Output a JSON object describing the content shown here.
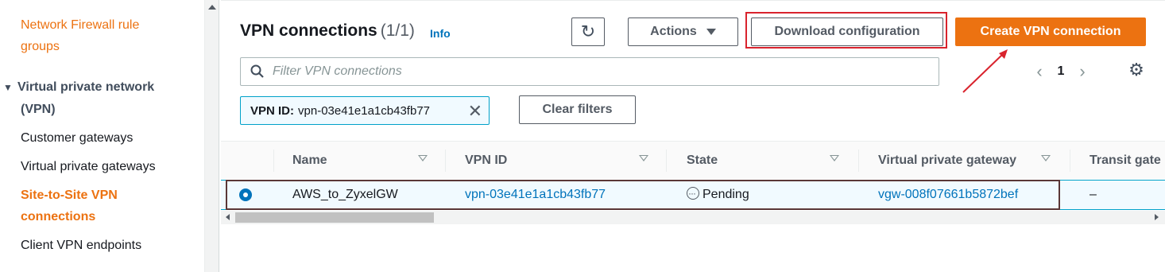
{
  "sidebar": {
    "items": [
      {
        "label": "Network Firewall rule",
        "label2": "groups"
      },
      {
        "section": "Virtual private network",
        "section2": "(VPN)"
      },
      {
        "label": "Customer gateways"
      },
      {
        "label": "Virtual private gateways"
      },
      {
        "label": "Site-to-Site VPN",
        "label2": "connections"
      },
      {
        "label": "Client VPN endpoints"
      }
    ]
  },
  "header": {
    "title": "VPN connections",
    "count": "(1/1)",
    "info": "Info"
  },
  "toolbar": {
    "refresh_icon": "refresh-icon",
    "actions_label": "Actions",
    "download_label": "Download configuration",
    "create_label": "Create VPN connection"
  },
  "search": {
    "placeholder": "Filter VPN connections"
  },
  "pagination": {
    "page": "1"
  },
  "filter_token": {
    "key": "VPN ID:",
    "value": "vpn-03e41e1a1cb43fb77"
  },
  "clear_filters_label": "Clear filters",
  "table": {
    "columns": [
      "Name",
      "VPN ID",
      "State",
      "Virtual private gateway",
      "Transit gate"
    ],
    "rows": [
      {
        "name": "AWS_to_ZyxelGW",
        "vpn_id": "vpn-03e41e1a1cb43fb77",
        "state": "Pending",
        "vgw": "vgw-008f07661b5872bef",
        "transit": "–"
      }
    ]
  },
  "colors": {
    "accent": "#ec7211",
    "link": "#0073bb",
    "highlight": "#d9232d"
  }
}
